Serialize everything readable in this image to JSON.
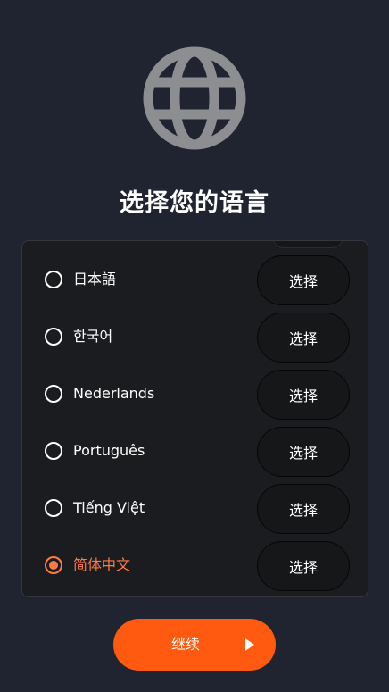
{
  "header": {
    "icon": "globe-icon",
    "title": "选择您的语言"
  },
  "languages": [
    {
      "label": "日本語",
      "button": "选择",
      "selected": false
    },
    {
      "label": "한국어",
      "button": "选择",
      "selected": false
    },
    {
      "label": "Nederlands",
      "button": "选择",
      "selected": false
    },
    {
      "label": "Português",
      "button": "选择",
      "selected": false
    },
    {
      "label": "Tiếng Việt",
      "button": "选择",
      "selected": false
    },
    {
      "label": "简体中文",
      "button": "选择",
      "selected": true
    }
  ],
  "footer": {
    "continue_label": "继续",
    "continue_icon": "play-icon"
  },
  "colors": {
    "background": "#1f2430",
    "panel": "#1b1c1f",
    "accent": "#ff5a10",
    "selected_text": "#ff7a45",
    "globe": "#8d8e92"
  }
}
